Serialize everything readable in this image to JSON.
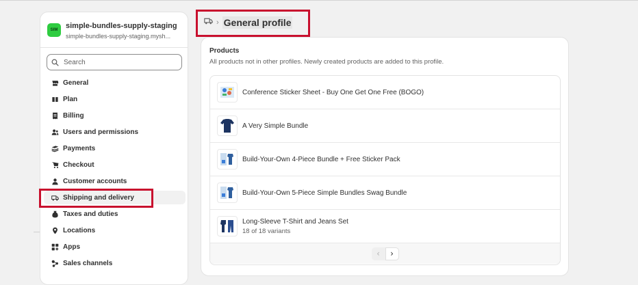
{
  "store": {
    "avatar_text": "SIM",
    "name": "simple-bundles-supply-staging",
    "domain": "simple-bundles-supply-staging.mysh..."
  },
  "search": {
    "placeholder": "Search"
  },
  "sidebar": {
    "items": [
      {
        "label": "General",
        "icon": "store-icon"
      },
      {
        "label": "Plan",
        "icon": "plan-icon"
      },
      {
        "label": "Billing",
        "icon": "billing-icon"
      },
      {
        "label": "Users and permissions",
        "icon": "users-icon"
      },
      {
        "label": "Payments",
        "icon": "payments-icon"
      },
      {
        "label": "Checkout",
        "icon": "cart-icon"
      },
      {
        "label": "Customer accounts",
        "icon": "person-icon"
      },
      {
        "label": "Shipping and delivery",
        "icon": "truck-icon",
        "active": true
      },
      {
        "label": "Taxes and duties",
        "icon": "tax-icon"
      },
      {
        "label": "Locations",
        "icon": "location-icon"
      },
      {
        "label": "Apps",
        "icon": "apps-icon"
      },
      {
        "label": "Sales channels",
        "icon": "channels-icon"
      }
    ]
  },
  "header": {
    "icon": "truck-icon",
    "separator": "›",
    "title": "General profile"
  },
  "products": {
    "title": "Products",
    "subtitle": "All products not in other profiles. Newly created products are added to this profile.",
    "items": [
      {
        "name": "Conference Sticker Sheet - Buy One Get One Free (BOGO)",
        "variants": ""
      },
      {
        "name": "A Very Simple Bundle",
        "variants": ""
      },
      {
        "name": "Build-Your-Own 4-Piece Bundle + Free Sticker Pack",
        "variants": ""
      },
      {
        "name": "Build-Your-Own 5-Piece Simple Bundles Swag Bundle",
        "variants": ""
      },
      {
        "name": "Long-Sleeve T-Shirt and Jeans Set",
        "variants": "18 of 18 variants"
      }
    ],
    "pager": {
      "prev": "‹",
      "next": "›"
    }
  },
  "colors": {
    "highlight": "#c8102e",
    "avatar": "#2ecc40",
    "background": "#f1f1f1"
  }
}
